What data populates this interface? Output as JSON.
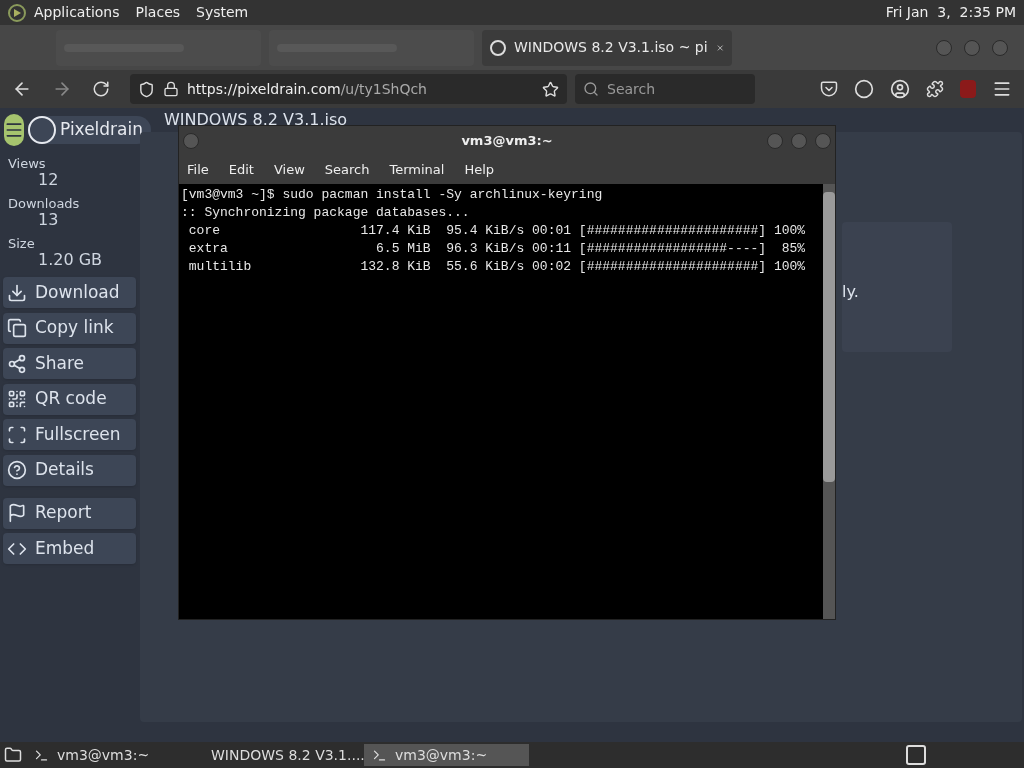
{
  "top_panel": {
    "menus": [
      "Applications",
      "Places",
      "System"
    ],
    "clock": "Fri Jan  3,  2:35 PM"
  },
  "browser": {
    "tabs": [
      {
        "selected": false
      },
      {
        "selected": false
      },
      {
        "title": "WINDOWS 8.2 V3.1.iso ~ pi",
        "selected": true
      }
    ],
    "url_host": "https://pixeldrain.com",
    "url_path": "/u/ty1ShQch",
    "search_placeholder": "Search"
  },
  "page": {
    "brand": "Pixeldrain",
    "file_name": "WINDOWS 8.2 V3.1.iso",
    "stats": [
      {
        "label": "Views",
        "value": "12"
      },
      {
        "label": "Downloads",
        "value": "13"
      },
      {
        "label": "Size",
        "value": "1.20 GB"
      }
    ],
    "actions": [
      {
        "kind": "download",
        "label": "Download"
      },
      {
        "kind": "copy",
        "label": "Copy link"
      },
      {
        "kind": "share",
        "label": "Share"
      },
      {
        "kind": "qr",
        "label": "QR code"
      },
      {
        "kind": "fullscreen",
        "label": "Fullscreen"
      },
      {
        "kind": "details",
        "label": "Details"
      }
    ],
    "secondary_actions": [
      {
        "kind": "report",
        "label": "Report"
      },
      {
        "kind": "embed",
        "label": "Embed"
      }
    ],
    "hidden_text": "ly."
  },
  "terminal": {
    "title": "vm3@vm3:~",
    "menu": [
      "File",
      "Edit",
      "View",
      "Search",
      "Terminal",
      "Help"
    ],
    "lines": [
      "[vm3@vm3 ~]$ sudo pacman install -Sy archlinux-keyring",
      ":: Synchronizing package databases...",
      " core                  117.4 KiB  95.4 KiB/s 00:01 [######################] 100%",
      " extra                   6.5 MiB  96.3 KiB/s 00:11 [##################----]  85%",
      " multilib              132.8 KiB  55.6 KiB/s 00:02 [######################] 100%"
    ]
  },
  "taskbar": [
    {
      "kind": "terminal",
      "label": "vm3@vm3:~",
      "selected": false
    },
    {
      "kind": "browser",
      "label": "WINDOWS 8.2 V3.1....",
      "selected": false
    },
    {
      "kind": "terminal",
      "label": "vm3@vm3:~",
      "selected": true
    }
  ]
}
